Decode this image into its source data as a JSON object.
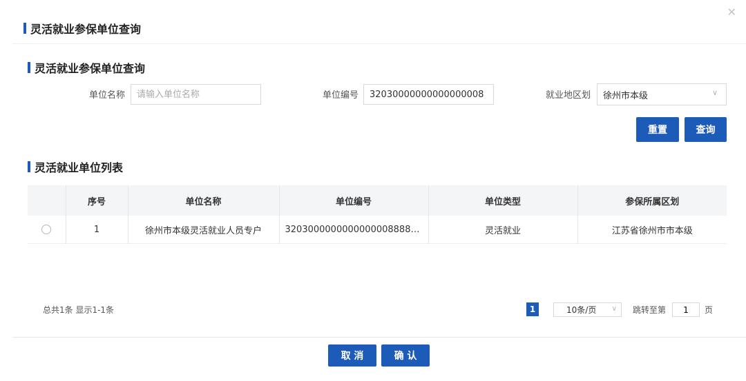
{
  "dialog": {
    "title": "灵活就业参保单位查询",
    "close_icon": "close-icon"
  },
  "search_section": {
    "title": "灵活就业参保单位查询",
    "unit_name_label": "单位名称",
    "unit_name_placeholder": "请输入单位名称",
    "unit_name_value": "",
    "unit_code_label": "单位编号",
    "unit_code_value": "32030000000000000008",
    "region_label": "就业地区划",
    "region_value": "徐州市本级",
    "reset_label": "重置",
    "query_label": "查询"
  },
  "list_section": {
    "title": "灵活就业单位列表",
    "columns": [
      "",
      "序号",
      "单位名称",
      "单位编号",
      "单位类型",
      "参保所属区划"
    ],
    "rows": [
      {
        "seq": "1",
        "unit_name": "徐州市本级灵活就业人员专户",
        "unit_code": "32030000000000000088888...",
        "unit_type": "灵活就业",
        "region": "江苏省徐州市市本级"
      }
    ]
  },
  "pagination": {
    "summary": "总共1条 显示1-1条",
    "current_page": "1",
    "page_size": "10条/页",
    "jump_label": "跳转至第",
    "jump_value": "1",
    "page_unit": "页"
  },
  "footer": {
    "cancel_label": "取 消",
    "confirm_label": "确 认"
  },
  "colors": {
    "primary": "#1d5bb8",
    "header_bg": "#f4f5f7"
  }
}
